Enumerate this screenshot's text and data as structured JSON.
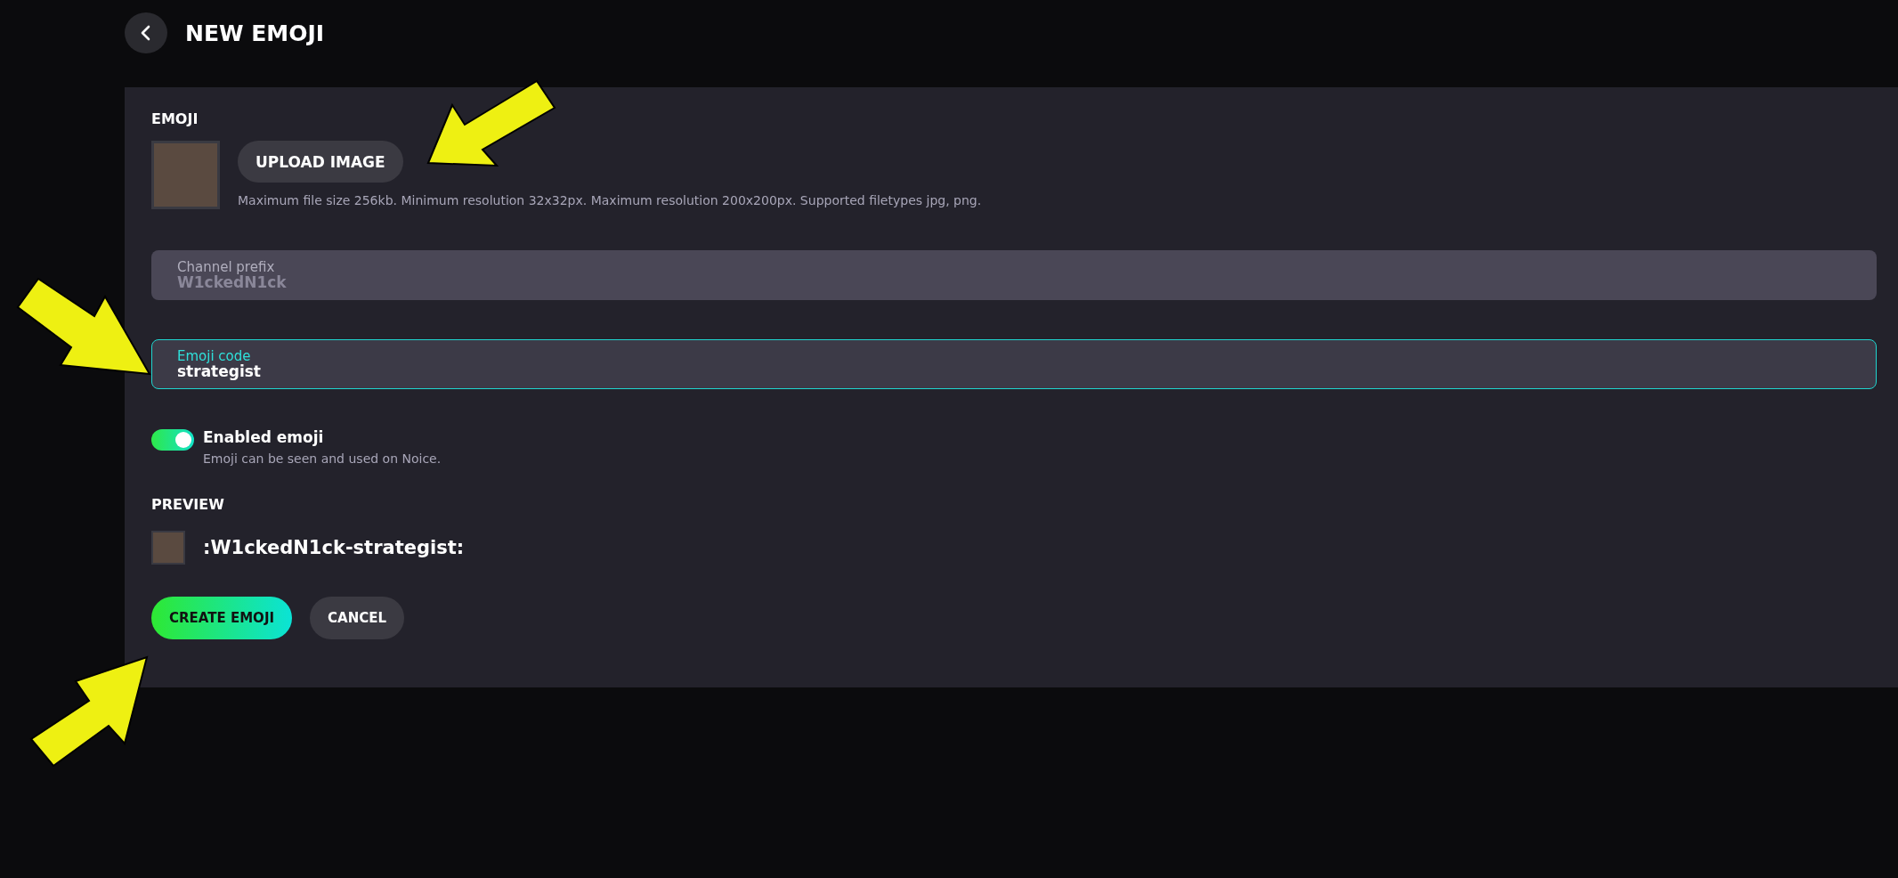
{
  "header": {
    "title": "NEW EMOJI"
  },
  "emoji": {
    "label": "EMOJI",
    "upload_button": "UPLOAD IMAGE",
    "hint": "Maximum file size 256kb. Minimum resolution 32x32px. Maximum resolution 200x200px. Supported filetypes jpg, png."
  },
  "fields": [
    {
      "label": "Channel prefix",
      "value": "W1ckedN1ck",
      "disabled": true,
      "focused": false
    },
    {
      "label": "Emoji code",
      "value": "strategist",
      "disabled": false,
      "focused": true
    }
  ],
  "toggle": {
    "label": "Enabled emoji",
    "description": "Emoji can be seen and used on Noice.",
    "on": true
  },
  "preview": {
    "label": "PREVIEW",
    "code": ":W1ckedN1ck-strategist:"
  },
  "buttons": [
    {
      "label": "CREATE EMOJI",
      "kind": "primary"
    },
    {
      "label": "CANCEL",
      "kind": "secondary"
    }
  ]
}
